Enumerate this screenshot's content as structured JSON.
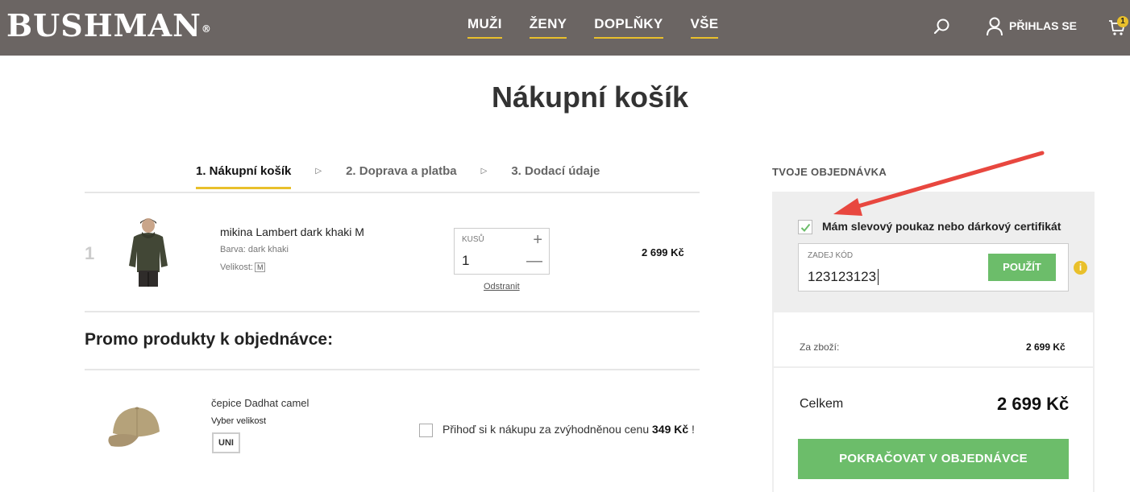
{
  "header": {
    "logo": "BUSHMAN",
    "logo_mark": "®",
    "nav": [
      "MUŽI",
      "ŽENY",
      "DOPLŇKY",
      "VŠE"
    ],
    "login_label": "PŘIHLAS SE",
    "cart_count": "1",
    "icons": {
      "search": "search-icon",
      "user": "user-icon",
      "cart": "cart-icon"
    }
  },
  "page": {
    "title": "Nákupní košík"
  },
  "steps": [
    {
      "label": "1. Nákupní košík",
      "active": true
    },
    {
      "label": "2. Doprava a platba",
      "active": false
    },
    {
      "label": "3. Dodací údaje",
      "active": false
    }
  ],
  "cart_item": {
    "index": "1",
    "name": "mikina Lambert dark khaki M",
    "color": "Barva: dark khaki",
    "size_label": "Velikost:",
    "size": "M",
    "qty_label": "KUSŮ",
    "qty": "1",
    "plus": "+",
    "minus": "—",
    "remove": "Odstranit",
    "price": "2 699 Kč"
  },
  "promo": {
    "title": "Promo produkty k objednávce:",
    "name": "čepice Dadhat camel",
    "size_label": "Vyber velikost",
    "size": "UNI",
    "offer_text": "Přihoď si k nákupu za zvýhodněnou cenu",
    "offer_price": "349 Kč",
    "offer_suffix": "!"
  },
  "order": {
    "title": "TVOJE OBJEDNÁVKA",
    "coupon_checkbox_label": "Mám slevový poukaz nebo dárkový certifikát",
    "coupon_checked": true,
    "code_label": "ZADEJ KÓD",
    "code_value": "123123123",
    "apply_label": "POUŽÍT",
    "info_glyph": "i",
    "subtotal_label": "Za zboží:",
    "subtotal_value": "2 699 Kč",
    "total_label": "Celkem",
    "total_value": "2 699 Kč",
    "continue_label": "POKRAČOVAT V OBJEDNÁVCE"
  },
  "colors": {
    "header_bg": "#6b6563",
    "accent_yellow": "#e9c02b",
    "button_green": "#6cbd6a",
    "annotation_red": "#e8473f"
  }
}
